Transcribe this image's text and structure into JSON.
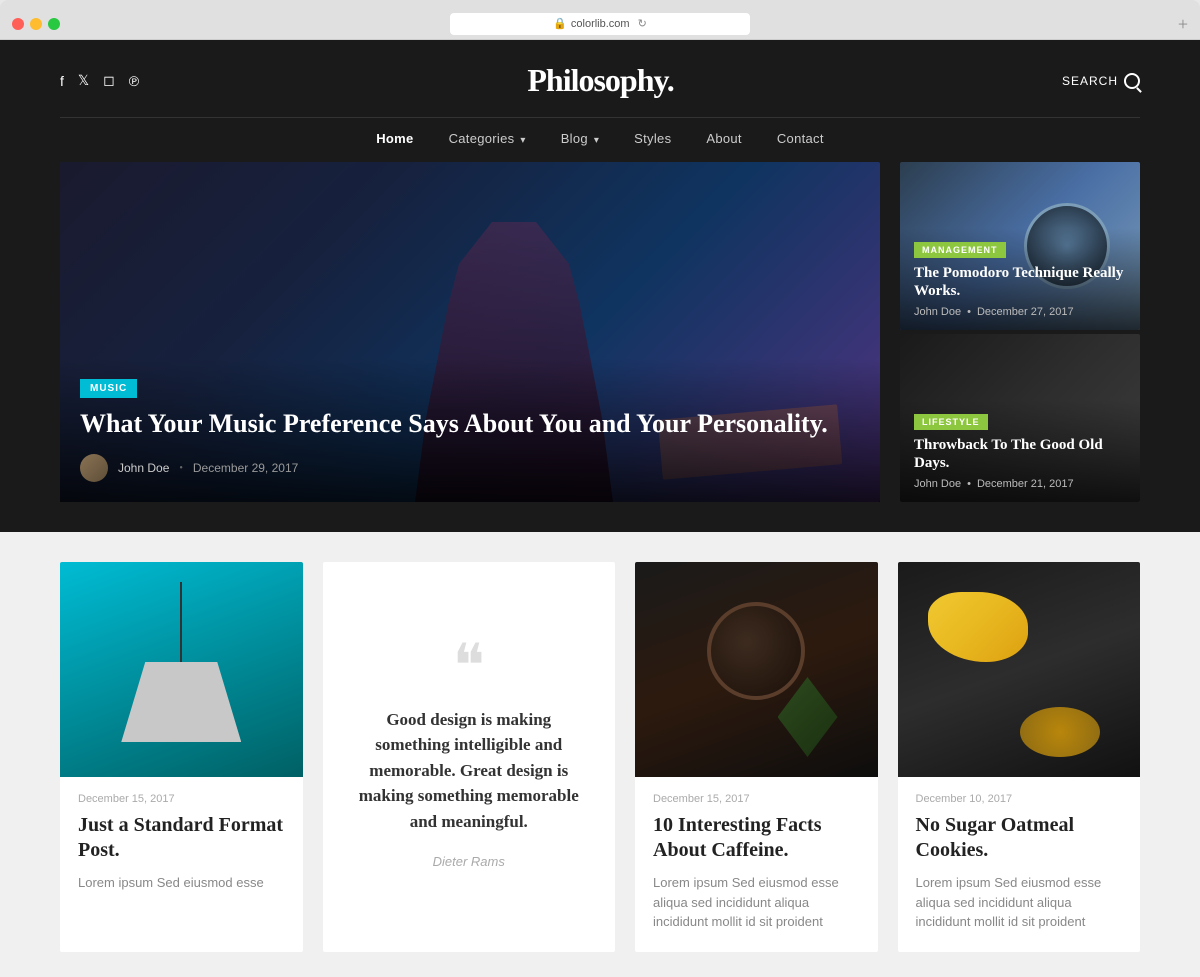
{
  "browser": {
    "url": "colorlib.com",
    "refresh_label": "↻",
    "add_tab_label": "+"
  },
  "header": {
    "logo": "Philosophy.",
    "search_label": "SEARCH",
    "social_icons": [
      {
        "name": "facebook",
        "symbol": "f"
      },
      {
        "name": "twitter",
        "symbol": "t"
      },
      {
        "name": "instagram",
        "symbol": "📷"
      },
      {
        "name": "pinterest",
        "symbol": "p"
      }
    ]
  },
  "nav": {
    "items": [
      {
        "label": "Home",
        "active": true
      },
      {
        "label": "Categories",
        "dropdown": true
      },
      {
        "label": "Blog",
        "dropdown": true
      },
      {
        "label": "Styles"
      },
      {
        "label": "About"
      },
      {
        "label": "Contact"
      }
    ]
  },
  "hero": {
    "category": "MUSIC",
    "title": "What Your Music Preference Says About You and Your Personality.",
    "author": "John Doe",
    "date": "December 29, 2017"
  },
  "side_cards": [
    {
      "category": "MANAGEMENT",
      "title": "The Pomodoro Technique Really Works.",
      "author": "John Doe",
      "date": "December 27, 2017"
    },
    {
      "category": "LIFESTYLE",
      "title": "Throwback To The Good Old Days.",
      "author": "John Doe",
      "date": "December 21, 2017"
    }
  ],
  "posts": [
    {
      "type": "image",
      "image_type": "lamp",
      "date": "December 15, 2017",
      "title": "Just a Standard Format Post.",
      "excerpt": "Lorem ipsum Sed eiusmod esse"
    },
    {
      "type": "quote",
      "quote_mark": "❝",
      "text": "Good design is making something intelligible and memorable. Great design is making something memorable and meaningful.",
      "author": "Dieter Rams"
    },
    {
      "type": "image",
      "image_type": "coffee",
      "date": "December 15, 2017",
      "title": "10 Interesting Facts About Caffeine.",
      "excerpt": "Lorem ipsum Sed eiusmod esse aliqua sed incididunt aliqua incididunt mollit id sit proident"
    },
    {
      "type": "image",
      "image_type": "cookies",
      "date": "December 10, 2017",
      "title": "No Sugar Oatmeal Cookies.",
      "excerpt": "Lorem ipsum Sed eiusmod esse aliqua sed incididunt aliqua incididunt mollit id sit proident"
    }
  ]
}
